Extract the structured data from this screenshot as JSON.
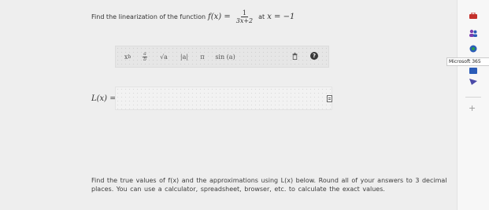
{
  "question": {
    "prefix": "Find the linearization of the function",
    "function_name": "f(x) =",
    "fraction_numerator": "1",
    "fraction_denominator": "3x+2",
    "at_label": "at",
    "point": "x = −1"
  },
  "toolbar": {
    "power": "x",
    "power_sup": "b",
    "fraction_num": "a",
    "fraction_den": "b",
    "sqrt": "√a",
    "abs": "|a|",
    "pi": "π",
    "sin": "sin (a)"
  },
  "answer": {
    "label": "L(x) ="
  },
  "instructions": {
    "text": "Find the true values of f(x) and the approximations using L(x) below. Round all of your answers to 3 decimal places. You can use a calculator, spreadsheet, browser, etc. to calculate the exact values."
  },
  "sidebar": {
    "microsoft_label": "Microsoft 365",
    "colors": {
      "red_icon": "#c4302b",
      "blue_icon": "#2b5cb8",
      "green_icon": "#2a9d4a",
      "orange_icon": "#e08a1e",
      "purple_icon": "#7a3fb0"
    }
  }
}
